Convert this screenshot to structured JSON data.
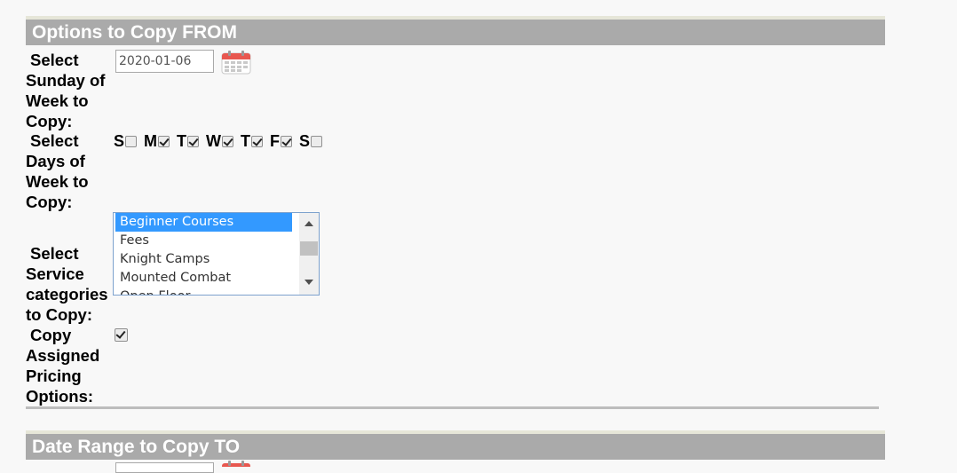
{
  "from_section": {
    "title": "Options to Copy FROM",
    "week_label": "Select Sunday of Week to Copy:",
    "week_value": "2020-01-06",
    "days_label": "Select Days of Week to Copy:",
    "days": [
      {
        "letter": "S",
        "checked": false
      },
      {
        "letter": "M",
        "checked": true
      },
      {
        "letter": "T",
        "checked": true
      },
      {
        "letter": "W",
        "checked": true
      },
      {
        "letter": "T",
        "checked": true
      },
      {
        "letter": "F",
        "checked": true
      },
      {
        "letter": "S",
        "checked": false
      }
    ],
    "categories_label": "Select Service categories to Copy:",
    "categories": [
      "Beginner Courses",
      "Fees",
      "Knight Camps",
      "Mounted Combat",
      "Open Floor"
    ],
    "selected_category": "Beginner Courses",
    "pricing_label": "Copy Assigned Pricing Options:",
    "pricing_checked": true
  },
  "to_section": {
    "title": "Date Range to Copy TO"
  },
  "icons": {
    "calendar": "calendar-icon"
  }
}
